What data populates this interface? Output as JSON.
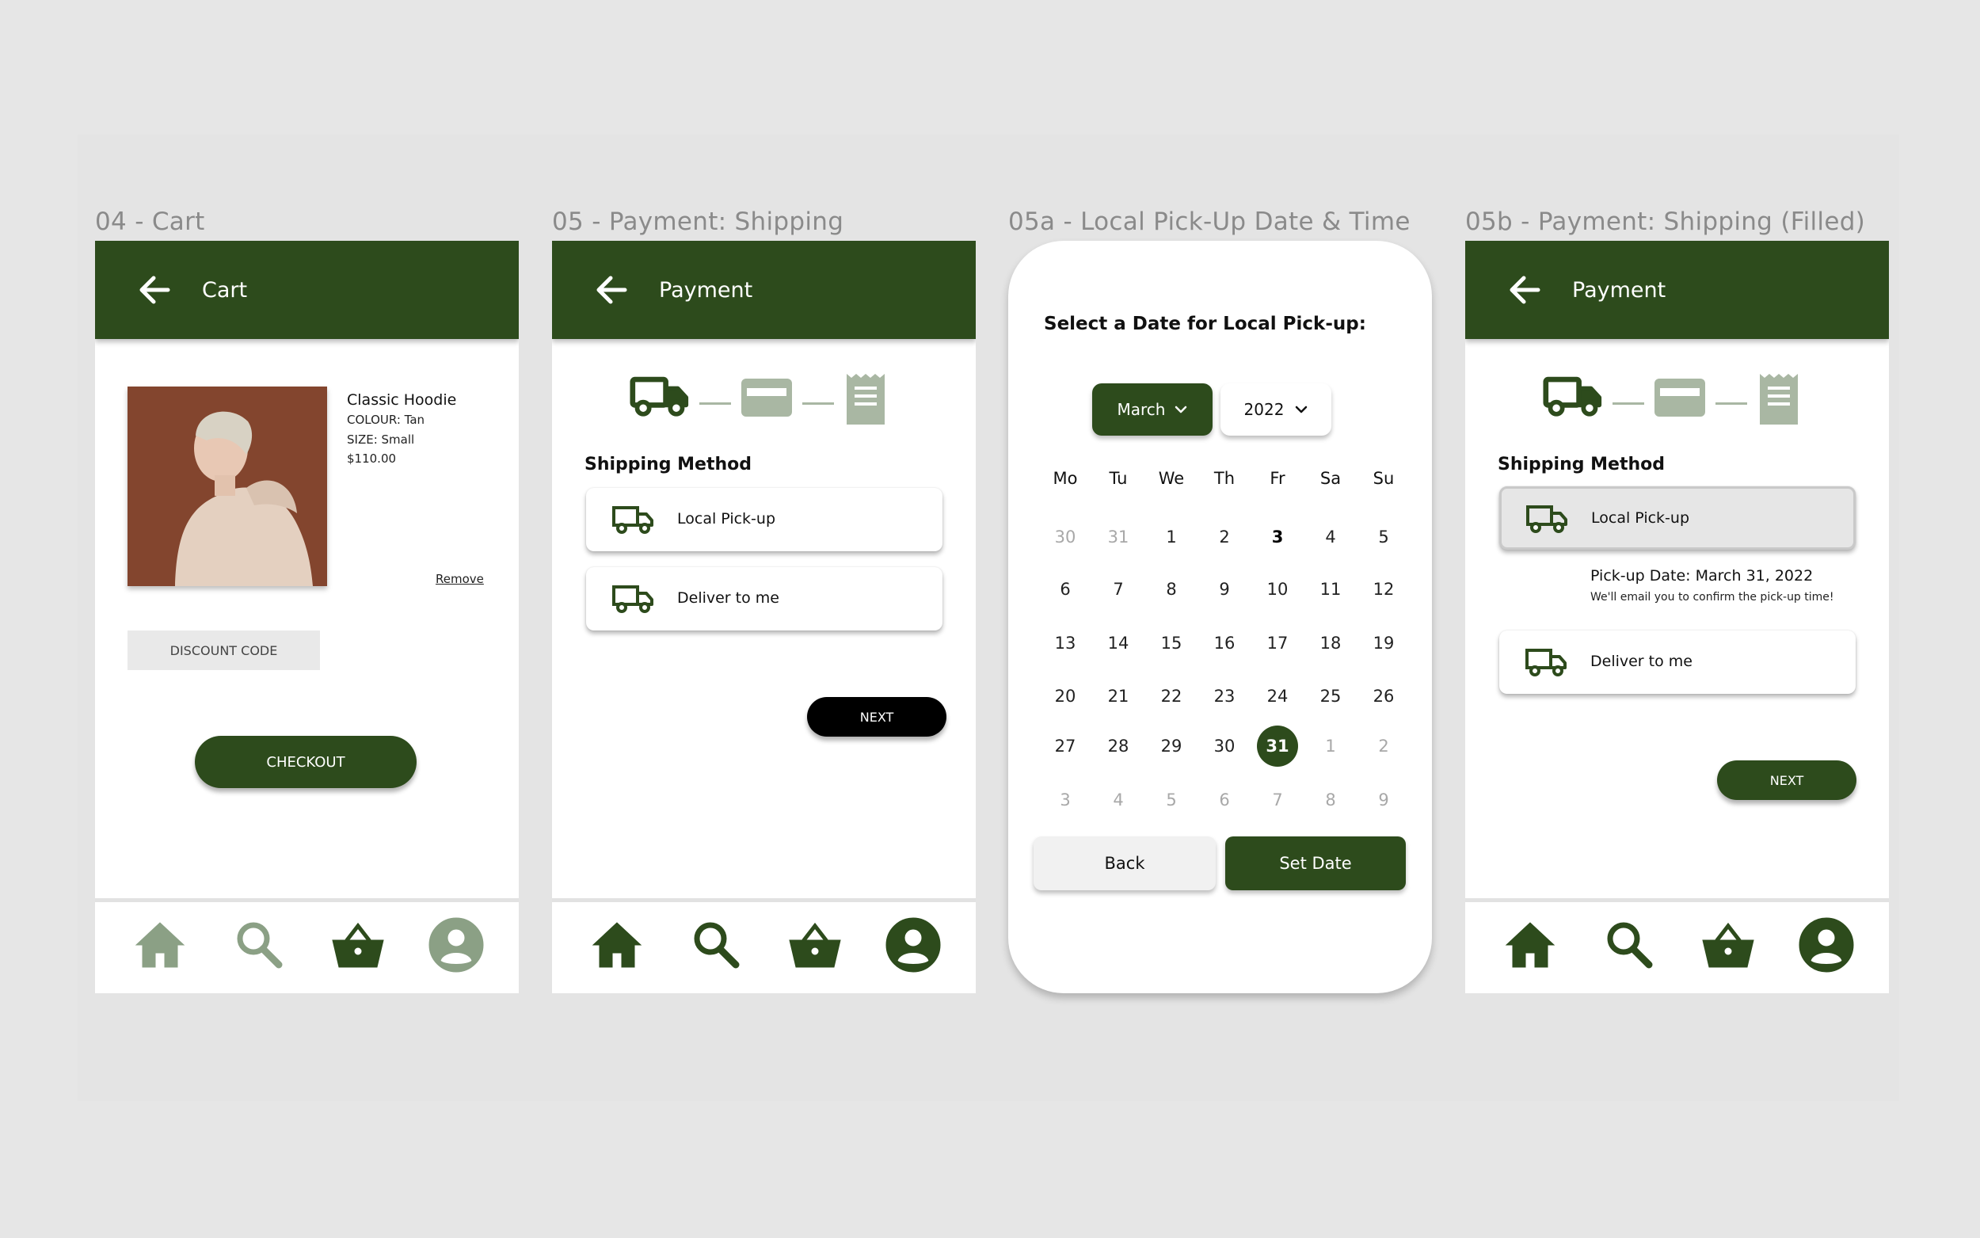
{
  "colors": {
    "brand_green": "#2d4b1c",
    "muted_green": "#8ba085",
    "background": "#e6e6e6"
  },
  "frames": {
    "cart": {
      "frame_title": "04 - Cart",
      "header_title": "Cart",
      "product": {
        "name": "Classic Hoodie",
        "colour": "COLOUR: Tan",
        "size": "SIZE: Small",
        "price": "$110.00"
      },
      "remove_label": "Remove",
      "discount_label": "DISCOUNT CODE",
      "checkout_label": "CHECKOUT",
      "nav_icons": [
        "home-icon",
        "search-icon",
        "basket-icon",
        "profile-icon"
      ]
    },
    "payment": {
      "frame_title": "05 - Payment: Shipping",
      "header_title": "Payment",
      "section_title": "Shipping Method",
      "options": [
        "Local Pick-up",
        "Deliver to me"
      ],
      "next_label": "NEXT",
      "step_icons": [
        "truck-icon",
        "card-icon",
        "receipt-icon"
      ]
    },
    "calendar": {
      "frame_title": "05a - Local Pick-Up Date & Time",
      "title": "Select a Date for Local Pick-up:",
      "month": "March",
      "year": "2022",
      "weekdays": [
        "Mo",
        "Tu",
        "We",
        "Th",
        "Fr",
        "Sa",
        "Su"
      ],
      "weeks": [
        [
          "30",
          "31",
          "1",
          "2",
          "3",
          "4",
          "5"
        ],
        [
          "6",
          "7",
          "8",
          "9",
          "10",
          "11",
          "12"
        ],
        [
          "13",
          "14",
          "15",
          "16",
          "17",
          "18",
          "19"
        ],
        [
          "20",
          "21",
          "22",
          "23",
          "24",
          "25",
          "26"
        ],
        [
          "27",
          "28",
          "29",
          "30",
          "31",
          "1",
          "2"
        ],
        [
          "3",
          "4",
          "5",
          "6",
          "7",
          "8",
          "9"
        ]
      ],
      "today": "3",
      "selected": "31",
      "back_label": "Back",
      "set_label": "Set Date"
    },
    "payment_filled": {
      "frame_title": "05b - Payment: Shipping (Filled)",
      "header_title": "Payment",
      "section_title": "Shipping Method",
      "options": [
        "Local Pick-up",
        "Deliver to me"
      ],
      "pickup_date": "Pick-up Date: March 31, 2022",
      "pickup_note": "We'll email you to confirm the pick-up time!",
      "next_label": "NEXT"
    }
  }
}
